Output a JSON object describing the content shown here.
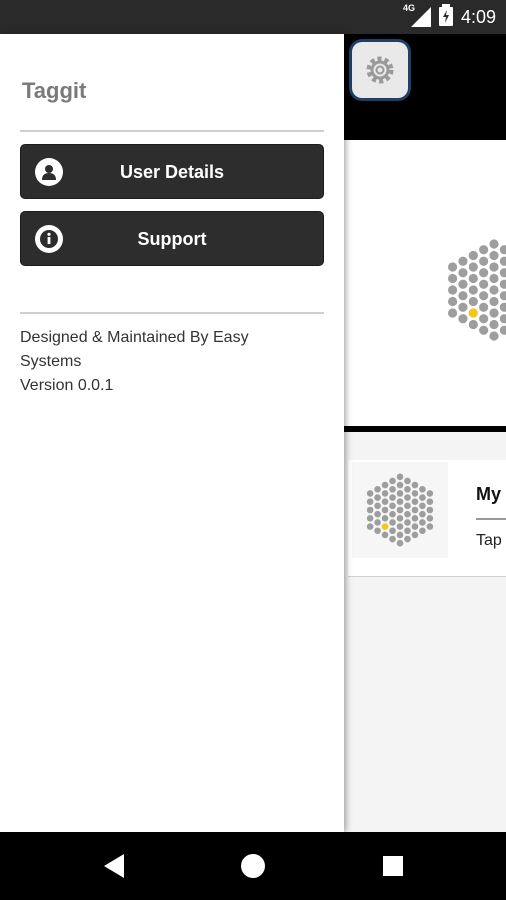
{
  "status_bar": {
    "network": "4G",
    "time": "4:09"
  },
  "drawer": {
    "title": "Taggit",
    "menu": [
      {
        "label": "User Details",
        "icon": "user-icon"
      },
      {
        "label": "Support",
        "icon": "info-icon"
      }
    ],
    "footer": {
      "credit": "Designed & Maintained By Easy Systems",
      "version": "Version 0.0.1"
    }
  },
  "background_app": {
    "card": {
      "title": "My",
      "subtitle": "Tap"
    }
  },
  "colors": {
    "accent_dot": "#f5c518",
    "hex_dot": "#9e9e9e",
    "button_bg": "#2d2d2d"
  }
}
